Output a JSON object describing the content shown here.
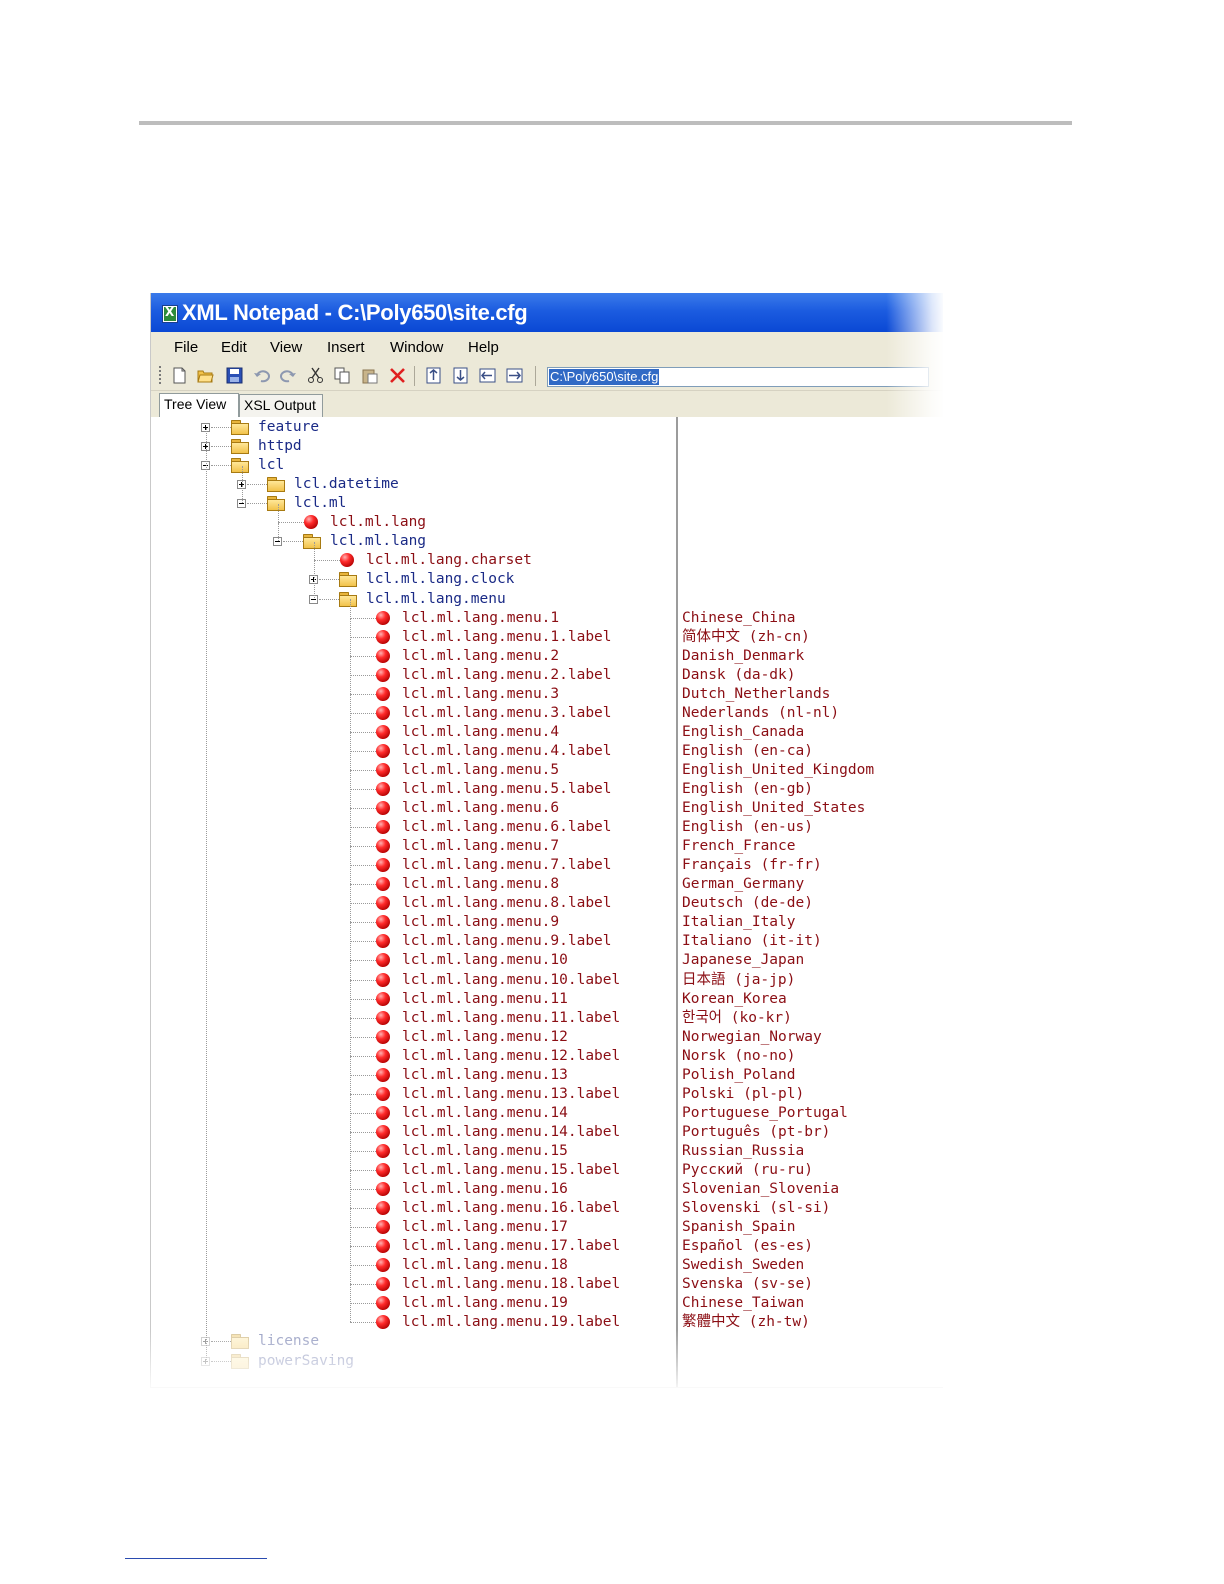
{
  "window": {
    "title": "XML Notepad - C:\\Poly650\\site.cfg",
    "app_icon": "xml-notepad-icon"
  },
  "menu": [
    "File",
    "Edit",
    "View",
    "Insert",
    "Window",
    "Help"
  ],
  "toolbar": {
    "buttons": [
      "new-icon",
      "open-icon",
      "save-icon",
      "undo-icon",
      "redo-icon",
      "cut-icon",
      "copy-icon",
      "paste-icon",
      "delete-icon",
      "nudge-up-icon",
      "nudge-down-icon",
      "nudge-left-icon",
      "nudge-right-icon"
    ],
    "location": "C:\\Poly650\\site.cfg"
  },
  "tabs": [
    "Tree View",
    "XSL Output"
  ],
  "tree": {
    "top": [
      {
        "label": "feature",
        "expanded": false
      },
      {
        "label": "httpd",
        "expanded": false
      },
      {
        "label": "lcl",
        "expanded": true
      }
    ],
    "lcl_children": [
      {
        "label": "lcl.datetime",
        "expanded": false
      },
      {
        "label": "lcl.ml",
        "expanded": true
      }
    ],
    "lcl_ml_children": [
      {
        "label": "lcl.ml.lang",
        "kind": "attribute"
      },
      {
        "label": "lcl.ml.lang",
        "kind": "folder",
        "expanded": true
      }
    ],
    "lang_children": [
      {
        "label": "lcl.ml.lang.charset",
        "kind": "attribute"
      },
      {
        "label": "lcl.ml.lang.clock",
        "kind": "folder",
        "expanded": false
      },
      {
        "label": "lcl.ml.lang.menu",
        "kind": "folder",
        "expanded": true
      }
    ],
    "menu_items": [
      {
        "name": "lcl.ml.lang.menu.1",
        "value": "Chinese_China"
      },
      {
        "name": "lcl.ml.lang.menu.1.label",
        "value": "简体中文 (zh-cn)"
      },
      {
        "name": "lcl.ml.lang.menu.2",
        "value": "Danish_Denmark"
      },
      {
        "name": "lcl.ml.lang.menu.2.label",
        "value": "Dansk (da-dk)"
      },
      {
        "name": "lcl.ml.lang.menu.3",
        "value": "Dutch_Netherlands"
      },
      {
        "name": "lcl.ml.lang.menu.3.label",
        "value": "Nederlands (nl-nl)"
      },
      {
        "name": "lcl.ml.lang.menu.4",
        "value": "English_Canada"
      },
      {
        "name": "lcl.ml.lang.menu.4.label",
        "value": "English (en-ca)"
      },
      {
        "name": "lcl.ml.lang.menu.5",
        "value": "English_United_Kingdom"
      },
      {
        "name": "lcl.ml.lang.menu.5.label",
        "value": "English (en-gb)"
      },
      {
        "name": "lcl.ml.lang.menu.6",
        "value": "English_United_States"
      },
      {
        "name": "lcl.ml.lang.menu.6.label",
        "value": "English (en-us)"
      },
      {
        "name": "lcl.ml.lang.menu.7",
        "value": "French_France"
      },
      {
        "name": "lcl.ml.lang.menu.7.label",
        "value": "Français (fr-fr)"
      },
      {
        "name": "lcl.ml.lang.menu.8",
        "value": "German_Germany"
      },
      {
        "name": "lcl.ml.lang.menu.8.label",
        "value": "Deutsch (de-de)"
      },
      {
        "name": "lcl.ml.lang.menu.9",
        "value": "Italian_Italy"
      },
      {
        "name": "lcl.ml.lang.menu.9.label",
        "value": "Italiano (it-it)"
      },
      {
        "name": "lcl.ml.lang.menu.10",
        "value": "Japanese_Japan"
      },
      {
        "name": "lcl.ml.lang.menu.10.label",
        "value": "日本語 (ja-jp)"
      },
      {
        "name": "lcl.ml.lang.menu.11",
        "value": "Korean_Korea"
      },
      {
        "name": "lcl.ml.lang.menu.11.label",
        "value": "한국어 (ko-kr)"
      },
      {
        "name": "lcl.ml.lang.menu.12",
        "value": "Norwegian_Norway"
      },
      {
        "name": "lcl.ml.lang.menu.12.label",
        "value": "Norsk (no-no)"
      },
      {
        "name": "lcl.ml.lang.menu.13",
        "value": "Polish_Poland"
      },
      {
        "name": "lcl.ml.lang.menu.13.label",
        "value": "Polski (pl-pl)"
      },
      {
        "name": "lcl.ml.lang.menu.14",
        "value": "Portuguese_Portugal"
      },
      {
        "name": "lcl.ml.lang.menu.14.label",
        "value": "Português (pt-br)"
      },
      {
        "name": "lcl.ml.lang.menu.15",
        "value": "Russian_Russia"
      },
      {
        "name": "lcl.ml.lang.menu.15.label",
        "value": "Русский (ru-ru)"
      },
      {
        "name": "lcl.ml.lang.menu.16",
        "value": "Slovenian_Slovenia"
      },
      {
        "name": "lcl.ml.lang.menu.16.label",
        "value": "Slovenski (sl-si)"
      },
      {
        "name": "lcl.ml.lang.menu.17",
        "value": "Spanish_Spain"
      },
      {
        "name": "lcl.ml.lang.menu.17.label",
        "value": "Español (es-es)"
      },
      {
        "name": "lcl.ml.lang.menu.18",
        "value": "Swedish_Sweden"
      },
      {
        "name": "lcl.ml.lang.menu.18.label",
        "value": "Svenska (sv-se)"
      },
      {
        "name": "lcl.ml.lang.menu.19",
        "value": "Chinese_Taiwan"
      },
      {
        "name": "lcl.ml.lang.menu.19.label",
        "value": "繁體中文 (zh-tw)"
      }
    ],
    "bottom": [
      {
        "label": "license",
        "expanded": false
      },
      {
        "label": "powerSaving",
        "expanded": false
      }
    ]
  },
  "colors": {
    "titlebar": "#0a48d4",
    "chrome": "#ece9d8",
    "folder_text": "#1a2a86",
    "attribute_text": "#8b0e14",
    "selection": "#316ac5"
  }
}
